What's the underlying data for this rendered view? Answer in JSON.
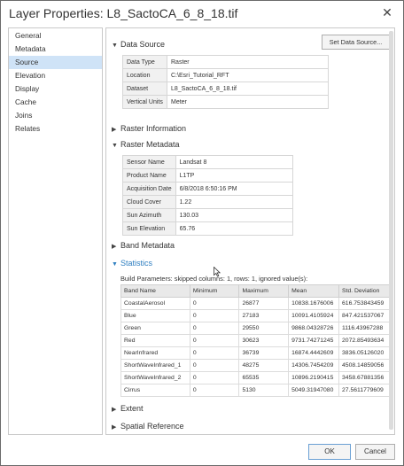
{
  "window": {
    "title": "Layer Properties: L8_SactoCA_6_8_18.tif"
  },
  "nav": {
    "items": [
      {
        "label": "General"
      },
      {
        "label": "Metadata"
      },
      {
        "label": "Source",
        "active": true
      },
      {
        "label": "Elevation"
      },
      {
        "label": "Display"
      },
      {
        "label": "Cache"
      },
      {
        "label": "Joins"
      },
      {
        "label": "Relates"
      }
    ]
  },
  "data_source": {
    "header": "Data Source",
    "button": "Set Data Source...",
    "rows": [
      {
        "k": "Data Type",
        "v": "Raster"
      },
      {
        "k": "Location",
        "v": "C:\\Esri_Tutorial_RFT"
      },
      {
        "k": "Dataset",
        "v": "L8_SactoCA_6_8_18.tif"
      },
      {
        "k": "Vertical Units",
        "v": "Meter"
      }
    ]
  },
  "raster_info": {
    "header": "Raster Information"
  },
  "raster_metadata": {
    "header": "Raster Metadata",
    "rows": [
      {
        "k": "Sensor Name",
        "v": "Landsat 8"
      },
      {
        "k": "Product Name",
        "v": "L1TP"
      },
      {
        "k": "Acquisition Date",
        "v": "6/8/2018 6:50:16 PM"
      },
      {
        "k": "Cloud Cover",
        "v": "1.22"
      },
      {
        "k": "Sun Azimuth",
        "v": "130.03"
      },
      {
        "k": "Sun Elevation",
        "v": "65.76"
      }
    ]
  },
  "band_metadata": {
    "header": "Band Metadata"
  },
  "statistics": {
    "header": "Statistics",
    "build_params": "Build Parameters: skipped columns: 1, rows: 1, ignored value(s):",
    "columns": [
      "Band Name",
      "Minimum",
      "Maximum",
      "Mean",
      "Std. Deviation"
    ],
    "rows": [
      [
        "CoastalAerosol",
        "0",
        "26877",
        "10838.1676006",
        "616.753843459"
      ],
      [
        "Blue",
        "0",
        "27183",
        "10091.4105924",
        "847.421537067"
      ],
      [
        "Green",
        "0",
        "29550",
        "9868.04328726",
        "1116.43967288"
      ],
      [
        "Red",
        "0",
        "30623",
        "9731.74271245",
        "2072.85493634"
      ],
      [
        "NearInfrared",
        "0",
        "36739",
        "16874.4442609",
        "3836.05126020"
      ],
      [
        "ShortWaveInfrared_1",
        "0",
        "48275",
        "14306.7454209",
        "4508.14859056"
      ],
      [
        "ShortWaveInfrared_2",
        "0",
        "65535",
        "10896.2190415",
        "3458.67881356"
      ],
      [
        "Cirrus",
        "0",
        "5130",
        "5049.31947080",
        "27.5611779609"
      ]
    ]
  },
  "extent": {
    "header": "Extent"
  },
  "spatial_reference": {
    "header": "Spatial Reference"
  },
  "footer": {
    "ok": "OK",
    "cancel": "Cancel"
  }
}
